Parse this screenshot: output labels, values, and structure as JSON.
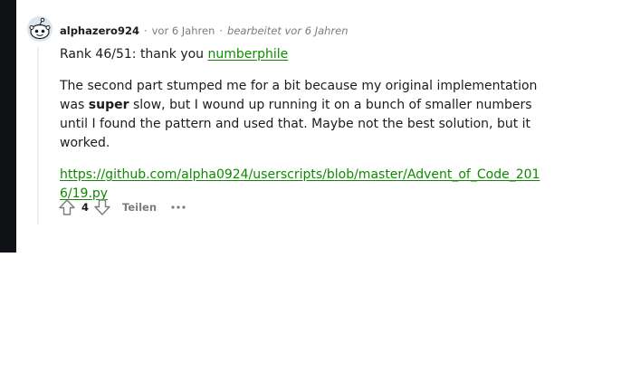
{
  "comment": {
    "author": "alphazero924",
    "separator": "·",
    "time": "vor 6 Jahren",
    "edited": "bearbeitet vor 6 Jahren",
    "line1_text": "Rank 46/51: thank you ",
    "line1_link": "numberphile",
    "para2_before": "The second part stumped me for a bit because my original implementation was ",
    "para2_bold": "super",
    "para2_after": " slow, but I wound up running it on a bunch of smaller numbers until I found the pattern and used that. Maybe not the best solution, but it worked.",
    "url": "https://github.com/alpha0924/userscripts/blob/master/Advent_of_Code_2016/19.py"
  },
  "actions": {
    "score": "4",
    "share_label": "Teilen",
    "upvote_icon": "arrow-up-outline",
    "downvote_icon": "arrow-down-outline",
    "more_icon": "ellipsis-horizontal"
  },
  "colors": {
    "link": "#0e8a00",
    "meta": "#7c7c7c",
    "text": "#1c1c1c",
    "left_bar": "#0f1114"
  }
}
